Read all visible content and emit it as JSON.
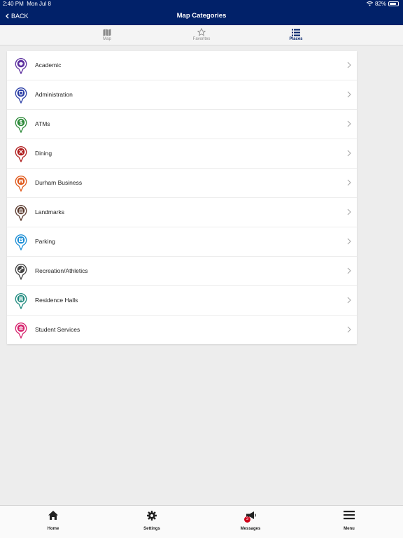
{
  "status": {
    "time": "2:40 PM",
    "date": "Mon Jul 8",
    "battery": "82%"
  },
  "nav": {
    "back_label": "BACK",
    "title": "Map Categories"
  },
  "tabs": [
    {
      "label": "Map",
      "icon": "map-icon",
      "active": false
    },
    {
      "label": "Favorites",
      "icon": "star-icon",
      "active": false
    },
    {
      "label": "Places",
      "icon": "list-icon",
      "active": true
    }
  ],
  "categories": [
    {
      "label": "Academic",
      "icon": "mortarboard-icon",
      "color": "#5b2e9e"
    },
    {
      "label": "Administration",
      "icon": "shield-icon",
      "color": "#2c3fa6"
    },
    {
      "label": "ATMs",
      "icon": "dollar-icon",
      "color": "#2e8b3a"
    },
    {
      "label": "Dining",
      "icon": "utensils-icon",
      "color": "#b01e1e"
    },
    {
      "label": "Durham Business",
      "icon": "storefront-icon",
      "color": "#e0591b"
    },
    {
      "label": "Landmarks",
      "icon": "landmark-icon",
      "color": "#5a3a2e"
    },
    {
      "label": "Parking",
      "icon": "parking-icon",
      "color": "#1e8fd6"
    },
    {
      "label": "Recreation/Athletics",
      "icon": "dumbbell-icon",
      "color": "#444444"
    },
    {
      "label": "Residence Halls",
      "icon": "building-icon",
      "color": "#1e8a7e"
    },
    {
      "label": "Student Services",
      "icon": "people-icon",
      "color": "#d6246e"
    }
  ],
  "bottom_tabs": [
    {
      "label": "Home",
      "icon": "home-icon"
    },
    {
      "label": "Settings",
      "icon": "gear-icon"
    },
    {
      "label": "Messages",
      "icon": "megaphone-icon",
      "badge": "3"
    },
    {
      "label": "Menu",
      "icon": "hamburger-icon"
    }
  ],
  "colors": {
    "header": "#012169",
    "background": "#ededed",
    "accent": "#012169"
  }
}
